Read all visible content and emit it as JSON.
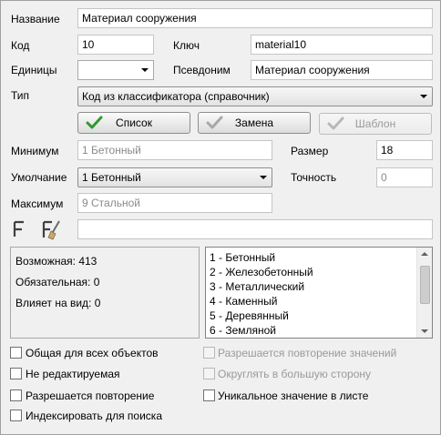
{
  "fields": {
    "name": {
      "label": "Название",
      "value": "Материал сооружения"
    },
    "code": {
      "label": "Код",
      "value": "10"
    },
    "key": {
      "label": "Ключ",
      "value": "material10"
    },
    "units": {
      "label": "Единицы",
      "value": ""
    },
    "alias": {
      "label": "Псевдоним",
      "value": "Материал сооружения"
    },
    "type": {
      "label": "Тип",
      "value": "Код из классификатора (справочник)"
    },
    "minimum": {
      "label": "Минимум",
      "value": "1 Бетонный"
    },
    "size": {
      "label": "Размер",
      "value": "18"
    },
    "default": {
      "label": "Умолчание",
      "value": "1 Бетонный"
    },
    "precision": {
      "label": "Точность",
      "value": "0"
    },
    "maximum": {
      "label": "Максимум",
      "value": "9 Стальной"
    },
    "formula": {
      "value": ""
    }
  },
  "buttons": {
    "list": "Список",
    "replace": "Замена",
    "template": "Шаблон"
  },
  "info": {
    "possible": "Возможная: 413",
    "required": "Обязательная: 0",
    "affects_view": "Влияет на вид: 0"
  },
  "list_items": [
    "1 - Бетонный",
    "2 - Железобетонный",
    "3 - Металлический",
    "4 - Каменный",
    "5 - Деревянный",
    "6 - Земляной"
  ],
  "checkboxes": {
    "common_all": "Общая для всех объектов",
    "not_editable": "Не редактируемая",
    "allow_repeat": "Разрешается повторение",
    "index_search": "Индексировать для поиска",
    "allow_repeat_values": "Разрешается повторение значений",
    "round_up": "Округлять в большую сторону",
    "unique_in_sheet": "Уникальное значение в листе"
  },
  "icons": {
    "formula": "formula-f-icon",
    "formula_brush": "formula-brush-icon",
    "check": "checkmark-icon"
  },
  "colors": {
    "check_green": "#2e9a2e",
    "check_gray": "#a8a8a8"
  }
}
